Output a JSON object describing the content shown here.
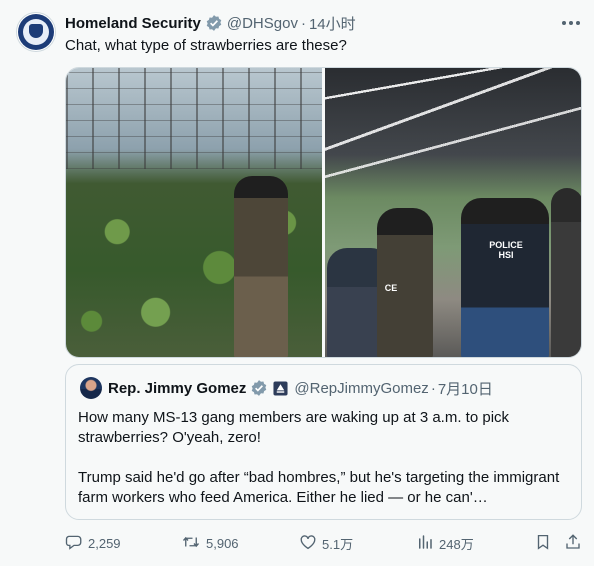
{
  "author": {
    "name": "Homeland Security",
    "handle": "@DHSgov",
    "separator": "·",
    "time": "14小时",
    "verified_color": "#829aab"
  },
  "tweet": {
    "text": "Chat, what type of strawberries are these?"
  },
  "media": {
    "right_photo_vest_label_1": "POLICE",
    "right_photo_vest_label_2": "HSI",
    "right_photo_partial_vest": "CE"
  },
  "quote": {
    "name": "Rep. Jimmy Gomez",
    "handle": "@RepJimmyGomez",
    "separator": "·",
    "time": "7月10日",
    "paragraph_1": "How many MS-13 gang members are waking up at 3 a.m. to pick strawberries? O'yeah, zero!",
    "paragraph_2": "Trump said he'd go after “bad hombres,” but he's targeting the immigrant farm workers who feed America. Either he lied — or he can'…"
  },
  "actions": {
    "replies": "2,259",
    "retweets": "5,906",
    "likes": "5.1万",
    "views": "248万"
  },
  "colors": {
    "background": "#f7f9f9",
    "text": "#0f1419",
    "secondary_text": "#536471",
    "border": "#cfd9de"
  },
  "icons": [
    "more-icon",
    "verified-badge-icon",
    "government-label-icon",
    "reply-icon",
    "retweet-icon",
    "like-icon",
    "views-icon",
    "bookmark-icon",
    "share-icon"
  ]
}
